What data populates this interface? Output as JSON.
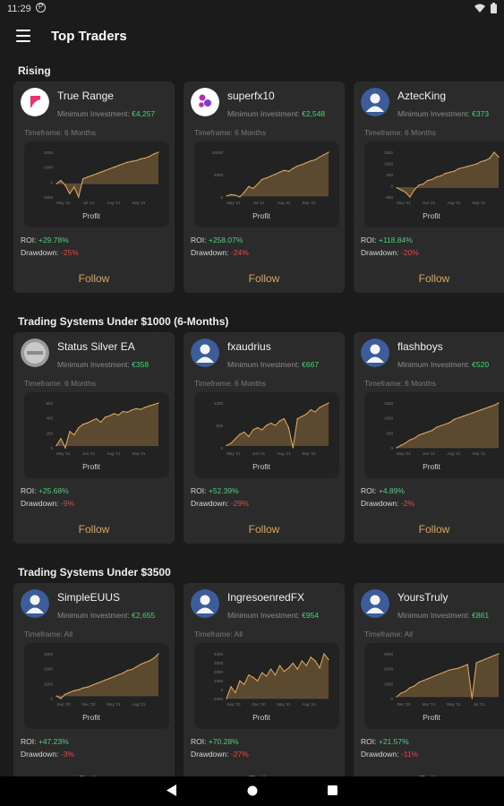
{
  "status": {
    "time": "11:29"
  },
  "app": {
    "title": "Top Traders"
  },
  "colors": {
    "accent": "#d9a45a",
    "positive": "#4cd07a",
    "negative": "#e54848",
    "card": "#2b2b2b"
  },
  "sections": [
    {
      "title": "Rising",
      "cards": [
        {
          "name": "True Range",
          "min_label": "Minimum Investment:",
          "min_value": "€4,257",
          "timeframe": "Timeframe: 6 Months",
          "roi_label": "ROI:",
          "roi_value": "+29.78%",
          "dd_label": "Drawdown:",
          "dd_value": "-25%",
          "follow": "Follow",
          "profit": "Profit",
          "avatar": "truerange-logo",
          "chart_data": {
            "type": "area",
            "yticks": [
              "2000",
              "1000",
              "0",
              "-1000"
            ],
            "xticks": [
              "May '21",
              "Jul '21",
              "Aug '21",
              "Sep '21"
            ],
            "values": [
              0,
              200,
              -100,
              -600,
              -200,
              -800,
              300,
              400,
              500,
              600,
              700,
              800,
              900,
              1000,
              1100,
              1200,
              1300,
              1350,
              1400,
              1500,
              1550,
              1650,
              1800,
              1900
            ]
          }
        },
        {
          "name": "superfx10",
          "min_label": "Minimum Investment:",
          "min_value": "€2,548",
          "timeframe": "Timeframe: 6 Months",
          "roi_label": "ROI:",
          "roi_value": "+258.07%",
          "dd_label": "Drawdown:",
          "dd_value": "-24%",
          "follow": "Follow",
          "profit": "Profit",
          "avatar": "superfx-logo",
          "chart_data": {
            "type": "area",
            "yticks": [
              "10000",
              "5000",
              "0"
            ],
            "xticks": [
              "May '21",
              "Jul '21",
              "Aug '21",
              "Sep '21"
            ],
            "values": [
              0,
              300,
              200,
              -200,
              800,
              2000,
              1600,
              2500,
              3500,
              3800,
              4200,
              4600,
              5000,
              5400,
              5200,
              5800,
              6300,
              6600,
              7000,
              7400,
              7600,
              8200,
              8700,
              9200
            ]
          }
        },
        {
          "name": "AztecKing",
          "min_label": "Minimum Investment:",
          "min_value": "€373",
          "timeframe": "Timeframe: 6 Months",
          "roi_label": "ROI:",
          "roi_value": "+118.84%",
          "dd_label": "Drawdown:",
          "dd_value": "-20%",
          "follow": "Follow",
          "profit": "Profit",
          "avatar": "person-avatar",
          "chart_data": {
            "type": "area",
            "yticks": [
              "1500",
              "1000",
              "500",
              "0",
              "-500"
            ],
            "xticks": [
              "May '21",
              "Jun '21",
              "Aug '21",
              "Sep '21"
            ],
            "values": [
              0,
              -100,
              -200,
              -400,
              -100,
              100,
              150,
              300,
              350,
              450,
              500,
              600,
              650,
              700,
              800,
              850,
              900,
              950,
              1000,
              1100,
              1150,
              1250,
              1500,
              1300
            ]
          }
        }
      ]
    },
    {
      "title": "Trading Systems Under $1000 (6-Months)",
      "cards": [
        {
          "name": "Status Silver EA",
          "min_label": "Minimum Investment:",
          "min_value": "€358",
          "timeframe": "Timeframe: 6 Months",
          "roi_label": "ROI:",
          "roi_value": "+25.68%",
          "dd_label": "Drawdown:",
          "dd_value": "-9%",
          "follow": "Follow",
          "profit": "Profit",
          "avatar": "silver-coin-logo",
          "chart_data": {
            "type": "area",
            "yticks": [
              "600",
              "400",
              "200",
              "0"
            ],
            "xticks": [
              "May '21",
              "Jun '21",
              "Aug '21",
              "Sep '21"
            ],
            "values": [
              0,
              100,
              -30,
              200,
              150,
              250,
              300,
              320,
              350,
              380,
              330,
              400,
              420,
              450,
              430,
              480,
              470,
              500,
              520,
              510,
              540,
              560,
              580,
              600
            ]
          }
        },
        {
          "name": "fxaudrius",
          "min_label": "Minimum Investment:",
          "min_value": "€667",
          "timeframe": "Timeframe: 6 Months",
          "roi_label": "ROI:",
          "roi_value": "+52.39%",
          "dd_label": "Drawdown:",
          "dd_value": "-29%",
          "follow": "Follow",
          "profit": "Profit",
          "avatar": "person-avatar",
          "chart_data": {
            "type": "area",
            "yticks": [
              "1000",
              "500",
              "0"
            ],
            "xticks": [
              "May '21",
              "Jun '21",
              "Aug '21",
              "Sep '21"
            ],
            "values": [
              0,
              50,
              150,
              250,
              300,
              200,
              350,
              400,
              350,
              450,
              500,
              450,
              550,
              600,
              400,
              -50,
              600,
              650,
              700,
              800,
              750,
              850,
              900,
              950
            ]
          }
        },
        {
          "name": "flashboys",
          "min_label": "Minimum Investment:",
          "min_value": "€520",
          "timeframe": "Timeframe: 6 Months",
          "roi_label": "ROI:",
          "roi_value": "+4.89%",
          "dd_label": "Drawdown:",
          "dd_value": "-2%",
          "follow": "Follow",
          "profit": "Profit",
          "avatar": "person-avatar",
          "chart_data": {
            "type": "area",
            "yticks": [
              "1500",
              "1000",
              "500",
              "0"
            ],
            "xticks": [
              "May '21",
              "Jun '21",
              "Aug '21",
              "Sep '21"
            ],
            "values": [
              0,
              80,
              150,
              250,
              300,
              400,
              450,
              500,
              550,
              650,
              700,
              750,
              800,
              900,
              950,
              1000,
              1050,
              1100,
              1150,
              1200,
              1250,
              1300,
              1350,
              1420
            ]
          }
        }
      ]
    },
    {
      "title": "Trading Systems Under $3500",
      "cards": [
        {
          "name": "SimpleEUUS",
          "min_label": "Minimum Investment:",
          "min_value": "€2,655",
          "timeframe": "Timeframe: All",
          "roi_label": "ROI:",
          "roi_value": "+47.23%",
          "dd_label": "Drawdown:",
          "dd_value": "-3%",
          "follow": "Follow",
          "profit": "Profit",
          "avatar": "person-avatar",
          "chart_data": {
            "type": "area",
            "yticks": [
              "3000",
              "2000",
              "1000",
              "0"
            ],
            "xticks": [
              "Sep '20",
              "Dec '20",
              "May '21",
              "Aug '21"
            ],
            "values": [
              0,
              -150,
              100,
              200,
              300,
              350,
              450,
              500,
              600,
              700,
              800,
              900,
              1000,
              1100,
              1200,
              1300,
              1450,
              1500,
              1650,
              1800,
              1900,
              2000,
              2150,
              2400
            ]
          }
        },
        {
          "name": "IngresoenredFX",
          "min_label": "Minimum Investment:",
          "min_value": "€954",
          "timeframe": "Timeframe: All",
          "roi_label": "ROI:",
          "roi_value": "+70.28%",
          "dd_label": "Drawdown:",
          "dd_value": "-27%",
          "follow": "Follow",
          "profit": "Profit",
          "avatar": "person-avatar",
          "chart_data": {
            "type": "area",
            "yticks": [
              "4000",
              "3000",
              "2000",
              "1000",
              "0",
              "-1000"
            ],
            "xticks": [
              "Sep '20",
              "Dec '20",
              "May '21",
              "Aug '21"
            ],
            "values": [
              0,
              1000,
              500,
              1500,
              1200,
              2000,
              1800,
              1500,
              2200,
              1900,
              2500,
              2000,
              2800,
              2300,
              2600,
              3000,
              2500,
              3200,
              2800,
              3500,
              3200,
              2600,
              3800,
              3300
            ]
          }
        },
        {
          "name": "YoursTruly",
          "min_label": "Minimum Investment:",
          "min_value": "€861",
          "timeframe": "Timeframe: All",
          "roi_label": "ROI:",
          "roi_value": "+21.57%",
          "dd_label": "Drawdown:",
          "dd_value": "-11%",
          "follow": "Follow",
          "profit": "Profit",
          "avatar": "person-avatar",
          "chart_data": {
            "type": "area",
            "yticks": [
              "3000",
              "2000",
              "1000",
              "0"
            ],
            "xticks": [
              "Dec '20",
              "Mar '21",
              "May '21",
              "Jul '21"
            ],
            "values": [
              0,
              200,
              300,
              500,
              600,
              800,
              900,
              1000,
              1100,
              1200,
              1300,
              1400,
              1500,
              1550,
              1600,
              1700,
              1800,
              -100,
              1900,
              2000,
              2100,
              2200,
              2300,
              2400
            ]
          }
        }
      ]
    }
  ]
}
